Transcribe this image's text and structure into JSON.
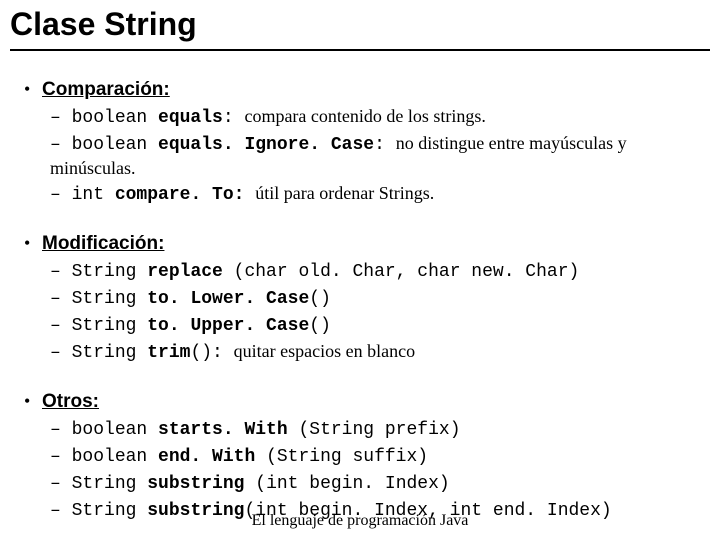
{
  "title": "Clase String",
  "footer": "El lenguaje de programación Java",
  "sections": [
    {
      "heading": "Comparación:",
      "items": [
        {
          "ret": "boolean ",
          "method": "equals",
          "sig": ": ",
          "desc": "compara contenido de los strings."
        },
        {
          "ret": "boolean ",
          "method": "equals. Ignore. Case",
          "sig": ": ",
          "desc": "no distingue entre mayúsculas y minúsculas."
        },
        {
          "ret": "int ",
          "method": "compare. To: ",
          "sig": "",
          "desc": "útil para ordenar Strings."
        }
      ]
    },
    {
      "heading": "Modificación:",
      "items": [
        {
          "ret": "String ",
          "method": "replace ",
          "sig": "(char old. Char, char new. Char)",
          "desc": ""
        },
        {
          "ret": "String ",
          "method": "to. Lower. Case",
          "sig": "()",
          "desc": ""
        },
        {
          "ret": "String ",
          "method": "to. Upper. Case",
          "sig": "()",
          "desc": ""
        },
        {
          "ret": "String ",
          "method": "trim",
          "sig": "(): ",
          "desc": "quitar espacios en blanco"
        }
      ]
    },
    {
      "heading": "Otros:",
      "items": [
        {
          "ret": "boolean ",
          "method": "starts. With ",
          "sig": "(String prefix)",
          "desc": ""
        },
        {
          "ret": "boolean ",
          "method": "end. With ",
          "sig": "(String suffix)",
          "desc": ""
        },
        {
          "ret": "String ",
          "method": "substring ",
          "sig": "(int begin. Index)",
          "desc": ""
        },
        {
          "ret": "String ",
          "method": "substring",
          "sig": "(int begin. Index, int end. Index)",
          "desc": ""
        }
      ]
    }
  ]
}
